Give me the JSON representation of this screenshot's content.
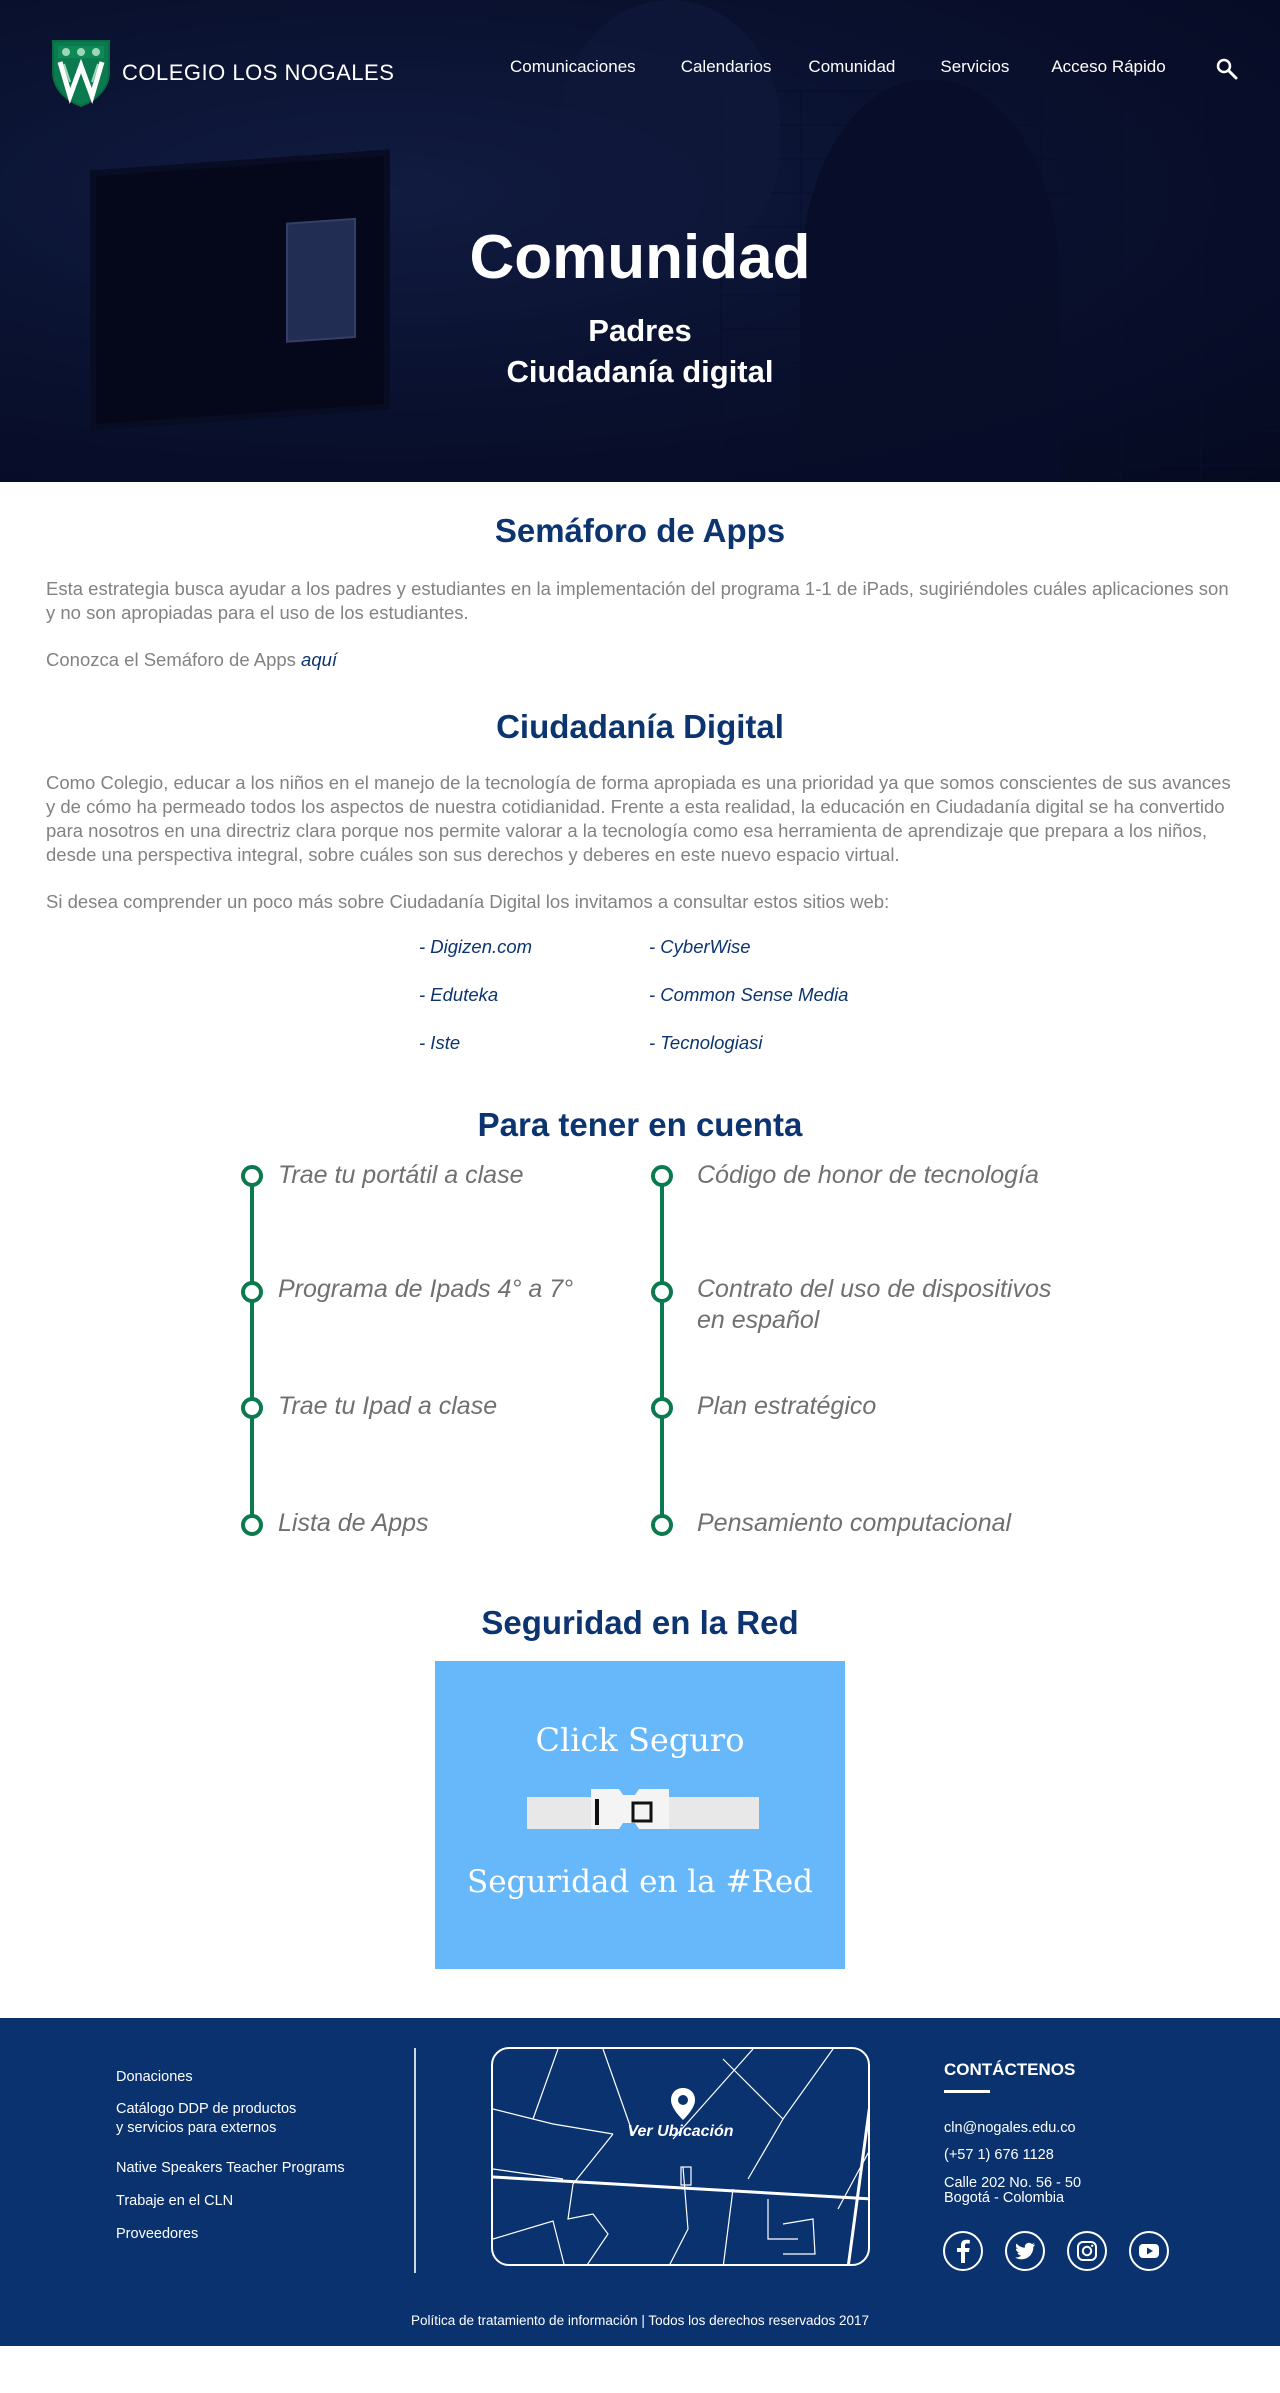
{
  "brand": {
    "name": "COLEGIO LOS NOGALES"
  },
  "nav": [
    "Comunicaciones",
    "Calendarios",
    "Comunidad",
    "Servicios",
    "Acceso Rápido"
  ],
  "hero": {
    "title": "Comunidad",
    "subtitle1": "Padres",
    "subtitle2": "Ciudadanía digital"
  },
  "semaforo": {
    "title": "Semáforo de Apps",
    "p1": "Esta estrategia busca ayudar a los padres y estudiantes en la implementación del programa 1-1 de iPads, sugiriéndoles cuáles aplicaciones son y no son apropiadas para el uso de los estudiantes.",
    "p2_prefix": "Conozca el Semáforo de Apps ",
    "p2_link": "aquí"
  },
  "ciudadania": {
    "title": "Ciudadanía Digital",
    "p1": "Como Colegio, educar a los niños en el manejo de la tecnología de forma apropiada es una prioridad ya que somos conscientes de sus avances y de cómo ha permeado todos los aspectos de nuestra cotidianidad. Frente a esta realidad, la educación en Ciudadanía digital se ha convertido para nosotros en una directriz clara porque nos permite valorar a la tecnología como esa herramienta de aprendizaje que prepara a los niños, desde una perspectiva integral, sobre cuáles son sus derechos y deberes en este nuevo espacio virtual.",
    "p2": "Si desea comprender un poco más sobre Ciudadanía Digital los invitamos a consultar estos sitios web:",
    "links": [
      "- Digizen.com",
      "- CyberWise",
      "- Eduteka",
      "- Common Sense Media",
      "- Iste",
      "- Tecnologiasi"
    ]
  },
  "cuenta": {
    "title": "Para tener en cuenta",
    "left": [
      "Trae tu portátil a clase",
      "Programa de Ipads 4° a 7°",
      "Trae tu Ipad a clase",
      "Lista de Apps"
    ],
    "right": [
      "Código de honor de tecnología",
      "Contrato del uso de dispositivos en español",
      "Plan estratégico",
      "Pensamiento computacional"
    ]
  },
  "seguridad": {
    "title": "Seguridad en la Red",
    "card_top": "Click Seguro",
    "card_bottom": "Seguridad en la #Red",
    "card_color": "#66b8fa"
  },
  "footer": {
    "links": [
      "Donaciones",
      "Catálogo DDP de productos",
      "y servicios para externos",
      "Native Speakers Teacher Programs",
      "Trabaje en el CLN",
      "Proveedores"
    ],
    "map_label": "Ver Ubicación",
    "contact_title": "CONTÁCTENOS",
    "email": "cln@nogales.edu.co",
    "phone": "(+57 1) 676 1128",
    "address1": "Calle 202 No. 56 - 50",
    "address2": "Bogotá - Colombia",
    "bottom": "Política de tratamiento de información | Todos los derechos reservados 2017",
    "bg_color": "#0a326f"
  },
  "colors": {
    "primary": "#0c3470",
    "accent_green": "#0b7a4e",
    "text_gray": "#828282"
  }
}
